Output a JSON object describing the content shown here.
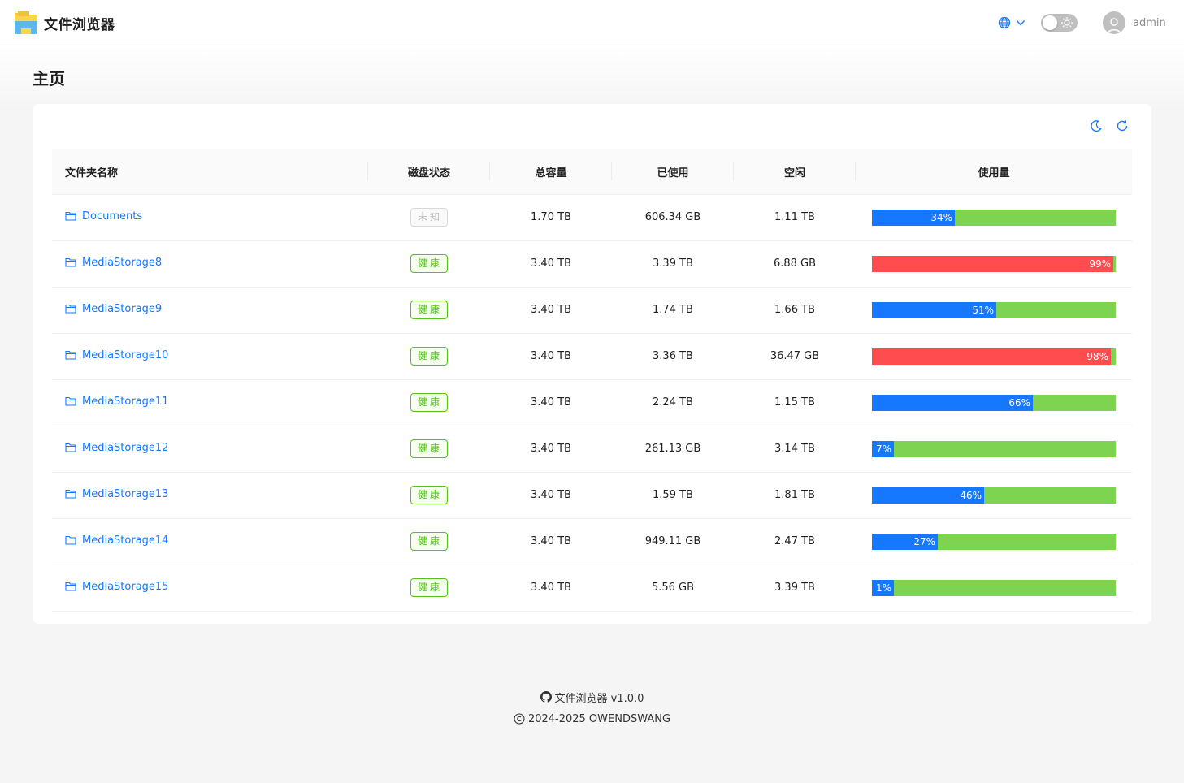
{
  "header": {
    "app_title": "文件浏览器",
    "language_icon": "globe-icon",
    "theme_toggle_icon": "sun-icon",
    "username": "admin"
  },
  "page": {
    "title": "主页"
  },
  "toolbar": {
    "dark_mode_icon": "moon-icon",
    "refresh_icon": "refresh-icon"
  },
  "table": {
    "columns": [
      "文件夹名称",
      "磁盘状态",
      "总容量",
      "已使用",
      "空闲",
      "使用量"
    ],
    "rows": [
      {
        "name": "Documents",
        "status": "未知",
        "status_type": "unknown",
        "total": "1.70 TB",
        "used": "606.34 GB",
        "free": "1.11 TB",
        "usage_pct": 34,
        "usage_label": "34%"
      },
      {
        "name": "MediaStorage8",
        "status": "健康",
        "status_type": "healthy",
        "total": "3.40 TB",
        "used": "3.39 TB",
        "free": "6.88 GB",
        "usage_pct": 99,
        "usage_label": "99%"
      },
      {
        "name": "MediaStorage9",
        "status": "健康",
        "status_type": "healthy",
        "total": "3.40 TB",
        "used": "1.74 TB",
        "free": "1.66 TB",
        "usage_pct": 51,
        "usage_label": "51%"
      },
      {
        "name": "MediaStorage10",
        "status": "健康",
        "status_type": "healthy",
        "total": "3.40 TB",
        "used": "3.36 TB",
        "free": "36.47 GB",
        "usage_pct": 98,
        "usage_label": "98%"
      },
      {
        "name": "MediaStorage11",
        "status": "健康",
        "status_type": "healthy",
        "total": "3.40 TB",
        "used": "2.24 TB",
        "free": "1.15 TB",
        "usage_pct": 66,
        "usage_label": "66%"
      },
      {
        "name": "MediaStorage12",
        "status": "健康",
        "status_type": "healthy",
        "total": "3.40 TB",
        "used": "261.13 GB",
        "free": "3.14 TB",
        "usage_pct": 7,
        "usage_label": "7%"
      },
      {
        "name": "MediaStorage13",
        "status": "健康",
        "status_type": "healthy",
        "total": "3.40 TB",
        "used": "1.59 TB",
        "free": "1.81 TB",
        "usage_pct": 46,
        "usage_label": "46%"
      },
      {
        "name": "MediaStorage14",
        "status": "健康",
        "status_type": "healthy",
        "total": "3.40 TB",
        "used": "949.11 GB",
        "free": "2.47 TB",
        "usage_pct": 27,
        "usage_label": "27%"
      },
      {
        "name": "MediaStorage15",
        "status": "健康",
        "status_type": "healthy",
        "total": "3.40 TB",
        "used": "5.56 GB",
        "free": "3.39 TB",
        "usage_pct": 1,
        "usage_label": "1%"
      }
    ]
  },
  "colors": {
    "usage_normal": "#1677ff",
    "usage_critical": "#ff4d4f",
    "usage_free": "#7ed450",
    "critical_threshold_pct": 90
  },
  "footer": {
    "github_icon": "github-icon",
    "app_version": "文件浏览器 v1.0.0",
    "copyright": "2024-2025 OWENDSWANG"
  }
}
